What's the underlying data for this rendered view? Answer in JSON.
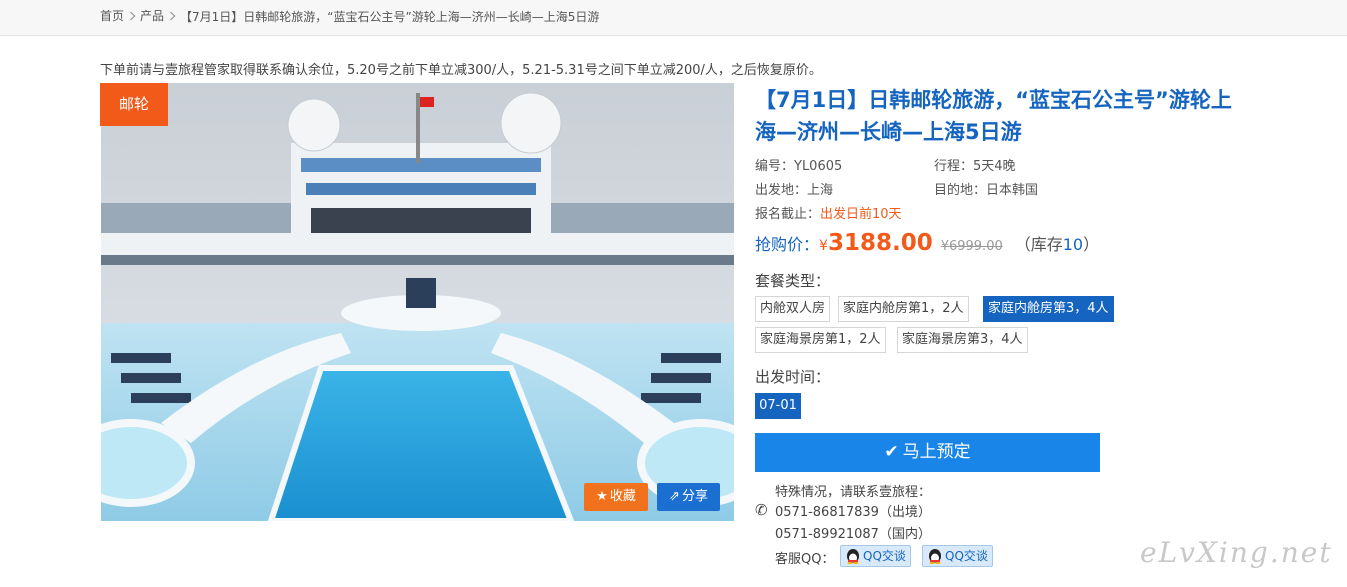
{
  "breadcrumb": {
    "home": "首页",
    "products": "产品",
    "current": "【7月1日】日韩邮轮旅游，“蓝宝石公主号”游轮上海—济州—长崎—上海5日游"
  },
  "notice": "下单前请与壹旅程管家取得联系确认余位，5.20号之前下单立减300/人，5.21-5.31号之间下单立减200/人，之后恢复原价。",
  "photo": {
    "tag": "邮轮",
    "favorite_label": "收藏",
    "share_label": "分享"
  },
  "product": {
    "title": "【7月1日】日韩邮轮旅游，“蓝宝石公主号”游轮上海—济州—长崎—上海5日游",
    "code": "编号：YL0605",
    "itinerary": "行程：5天4晚",
    "departure": "出发地：上海",
    "destination": "目的地：日本韩国",
    "deadline_label": "报名截止：",
    "deadline_value": "出发日前10天"
  },
  "price": {
    "label": "抢购价：",
    "currency": "¥",
    "value": "3188.00",
    "original": "¥6999.00",
    "stock_prefix": "（库存",
    "stock_num": "10",
    "stock_suffix": "）"
  },
  "packages": {
    "label": "套餐类型：",
    "items": [
      "内舱双人房",
      "家庭内舱房第1，2人",
      "家庭内舱房第3，4人",
      "家庭海景房第1，2人",
      "家庭海景房第3，4人"
    ],
    "selected": "家庭内舱房第3，4人"
  },
  "departure_time": {
    "label": "出发时间：",
    "date": "07-01"
  },
  "book_button": "马上预定",
  "contact": {
    "special": "特殊情况，请联系壹旅程：",
    "phone1": "0571-86817839（出境）",
    "phone2": "0571-89921087（国内）",
    "qq_label": "客服QQ：",
    "qq1": "QQ交谈",
    "qq2": "QQ交谈"
  },
  "watermark": "eLvXing.net",
  "colors": {
    "accent_blue": "#1565c0",
    "button_blue": "#1a85e8",
    "accent_orange": "#f25a1a"
  }
}
